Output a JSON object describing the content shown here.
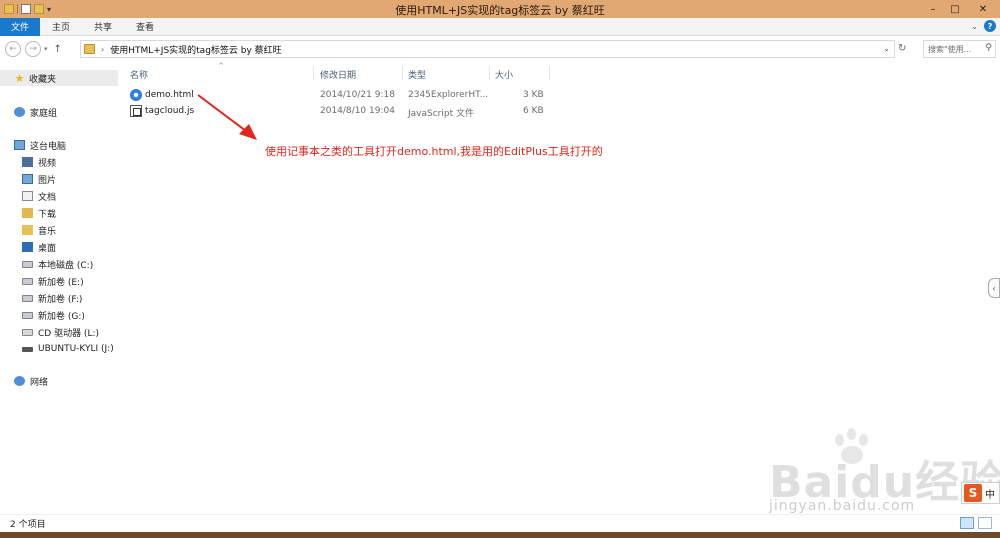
{
  "window": {
    "title": "使用HTML+JS实现的tag标签云 by 蔡红旺",
    "controls": [
      "minimize",
      "maximize",
      "close"
    ]
  },
  "ribbon": {
    "tabs": [
      "文件",
      "主页",
      "共享",
      "查看"
    ]
  },
  "nav": {
    "back": "back-arrow",
    "forward": "forward-arrow",
    "up": "up-arrow",
    "path": "使用HTML+JS实现的tag标签云 by 蔡红旺",
    "search_placeholder": "搜索\"使用..."
  },
  "sidebar": {
    "favorites": "收藏夹",
    "homegroup": "家庭组",
    "this_pc": "这台电脑",
    "items": [
      "视频",
      "图片",
      "文档",
      "下载",
      "音乐",
      "桌面"
    ],
    "drives": [
      "本地磁盘 (C:)",
      "新加卷 (E:)",
      "新加卷 (F:)",
      "新加卷 (G:)",
      "CD 驱动器 (L:)",
      "UBUNTU-KYLI (J:)"
    ],
    "network": "网络"
  },
  "columns": {
    "name": "名称",
    "date": "修改日期",
    "type": "类型",
    "size": "大小"
  },
  "files": [
    {
      "name": "demo.html",
      "date": "2014/10/21 9:18",
      "type": "2345ExplorerHT...",
      "size": "3 KB",
      "icon": "html-icon"
    },
    {
      "name": "tagcloud.js",
      "date": "2014/8/10 19:04",
      "type": "JavaScript 文件",
      "size": "6 KB",
      "icon": "js-icon"
    }
  ],
  "annotation": "使用记事本之类的工具打开demo.html,我是用的EditPlus工具打开的",
  "annotation_color": "#e1261c",
  "status": {
    "item_count": "2 个项目"
  },
  "watermark": {
    "main": "Baidu经验",
    "sub": "jingyan.baidu.com"
  },
  "ime": {
    "logo": "S",
    "lang": "中"
  }
}
